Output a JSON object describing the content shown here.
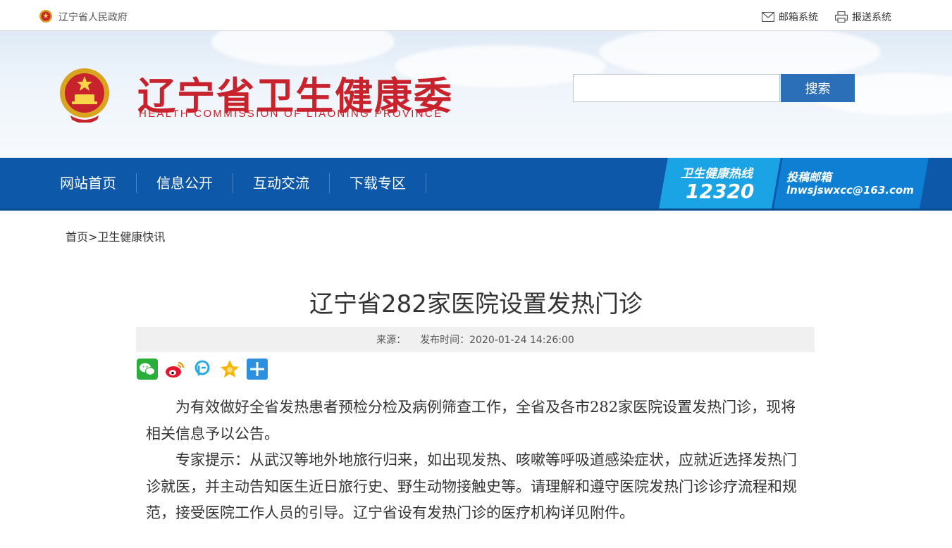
{
  "topbar": {
    "gov_link": "辽宁省人民政府",
    "mail_link": "邮箱系统",
    "report_link": "报送系统"
  },
  "header": {
    "title_cn": "辽宁省卫生健康委",
    "title_en": "HEALTH COMMISSION OF LIAONING PROVINCE",
    "search": {
      "value": "",
      "button_label": "搜索"
    }
  },
  "nav": {
    "items": [
      "网站首页",
      "信息公开",
      "互动交流",
      "下载专区"
    ],
    "hotline_label": "卫生健康热线",
    "hotline_number": "12320",
    "mailbox_label": "投稿邮箱",
    "mailbox_email": "lnwsjswxcc@163.com"
  },
  "breadcrumb": {
    "home": "首页",
    "separator": ">",
    "current": "卫生健康快讯"
  },
  "article": {
    "title": "辽宁省282家医院设置发热门诊",
    "source_label": "来源：",
    "publish_label": "发布时间：",
    "publish_time": "2020-01-24 14:26:00",
    "share_icons": [
      "wechat-icon",
      "weibo-icon",
      "qzone-icon",
      "favorite-icon",
      "more-share-icon"
    ],
    "paragraphs": [
      "为有效做好全省发热患者预检分检及病例筛查工作，全省及各市282家医院设置发热门诊，现将相关信息予以公告。",
      "专家提示：从武汉等地外地旅行归来，如出现发热、咳嗽等呼吸道感染症状，应就近选择发热门诊就医，并主动告知医生近日旅行史、野生动物接触史等。请理解和遵守医院发热门诊诊疗流程和规范，接受医院工作人员的引导。辽宁省设有发热门诊的医疗机构详见附件。"
    ]
  },
  "colors": {
    "brand_red": "#c8232c",
    "nav_blue": "#0d58a8",
    "hotline_blue": "#1aa4e6",
    "search_blue": "#2b6fb8"
  }
}
